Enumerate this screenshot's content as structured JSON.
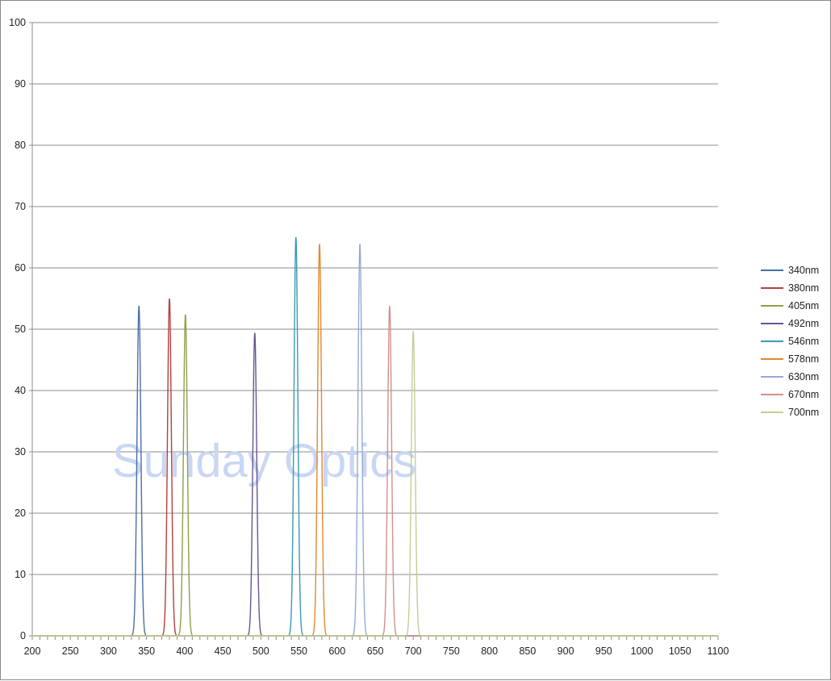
{
  "watermark_text": "Sunday Optics",
  "chart_data": {
    "type": "line",
    "title": "",
    "xlabel": "",
    "ylabel": "",
    "xlim": [
      200,
      1100
    ],
    "ylim": [
      0,
      100
    ],
    "x_ticks": [
      200,
      250,
      300,
      350,
      400,
      450,
      500,
      550,
      600,
      650,
      700,
      750,
      800,
      850,
      900,
      950,
      1000,
      1050,
      1100
    ],
    "x_minor_step": 10,
    "y_ticks": [
      0,
      10,
      20,
      30,
      40,
      50,
      60,
      70,
      80,
      90,
      100
    ],
    "grid": "horizontal",
    "legend_position": "right",
    "series": [
      {
        "name": "340nm",
        "color": "#4a6fa5",
        "peak_x": 340,
        "peak_y": 53.8,
        "fwhm": 6
      },
      {
        "name": "380nm",
        "color": "#b5403f",
        "peak_x": 380,
        "peak_y": 55.0,
        "fwhm": 6
      },
      {
        "name": "405nm",
        "color": "#8ea04a",
        "peak_x": 401,
        "peak_y": 52.4,
        "fwhm": 6
      },
      {
        "name": "492nm",
        "color": "#6a5592",
        "peak_x": 492,
        "peak_y": 49.4,
        "fwhm": 6
      },
      {
        "name": "546nm",
        "color": "#3a9bb0",
        "peak_x": 546,
        "peak_y": 65.0,
        "fwhm": 6
      },
      {
        "name": "578nm",
        "color": "#e2882f",
        "peak_x": 577,
        "peak_y": 63.9,
        "fwhm": 6
      },
      {
        "name": "630nm",
        "color": "#94aad3",
        "peak_x": 630,
        "peak_y": 63.9,
        "fwhm": 6
      },
      {
        "name": "670nm",
        "color": "#d48f8d",
        "peak_x": 669,
        "peak_y": 53.8,
        "fwhm": 6
      },
      {
        "name": "700nm",
        "color": "#c3cf98",
        "peak_x": 700,
        "peak_y": 49.7,
        "fwhm": 6
      }
    ]
  }
}
